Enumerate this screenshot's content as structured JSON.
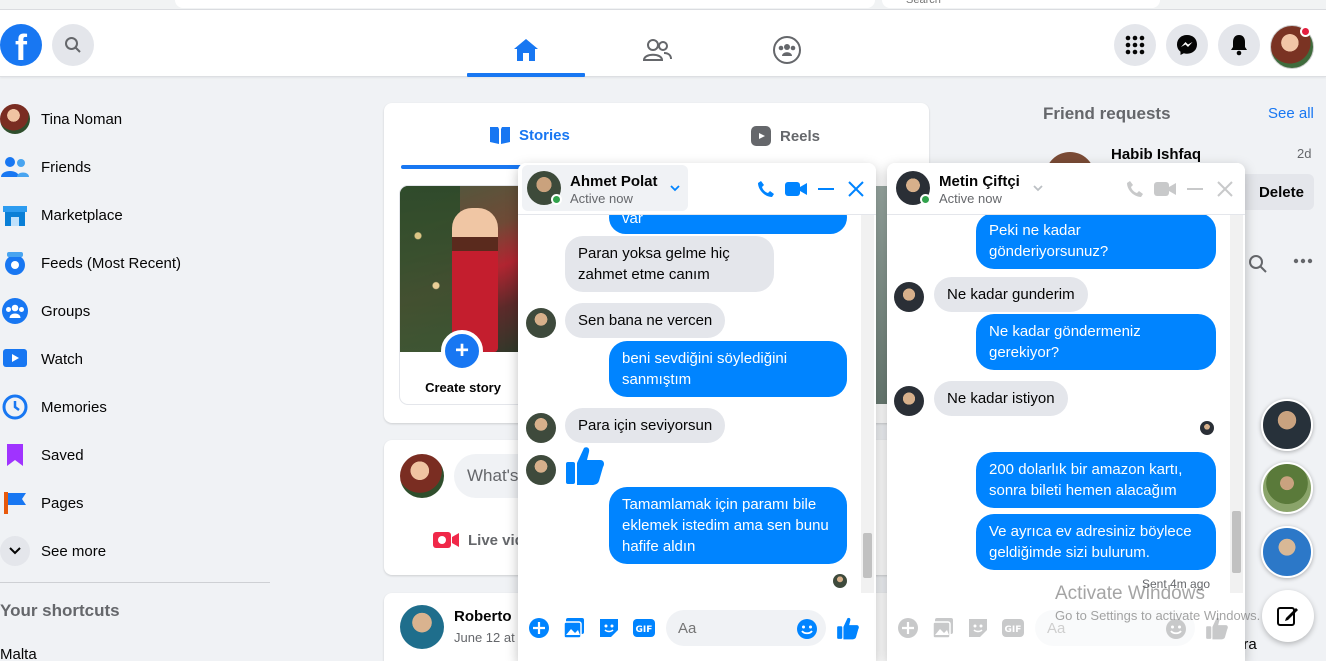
{
  "browser": {
    "search_placeholder": "Search"
  },
  "topbar": {
    "logo": "f",
    "colors": {
      "brand": "#1877f2",
      "notif_dot": "#e41e3f"
    }
  },
  "sidebar": {
    "items": [
      {
        "label": "Tina Noman",
        "icon": "profile-avatar"
      },
      {
        "label": "Friends",
        "icon": "friends-icon"
      },
      {
        "label": "Marketplace",
        "icon": "marketplace-icon"
      },
      {
        "label": "Feeds (Most Recent)",
        "icon": "feeds-icon"
      },
      {
        "label": "Groups",
        "icon": "groups-icon"
      },
      {
        "label": "Watch",
        "icon": "watch-icon"
      },
      {
        "label": "Memories",
        "icon": "memories-icon"
      },
      {
        "label": "Saved",
        "icon": "saved-icon"
      },
      {
        "label": "Pages",
        "icon": "pages-icon"
      },
      {
        "label": "See more",
        "icon": "chevron-down-icon"
      }
    ],
    "shortcuts_title": "Your shortcuts",
    "shortcut_item": "Malta"
  },
  "feed": {
    "tabs": {
      "stories": "Stories",
      "reels": "Reels"
    },
    "create_story": "Create story",
    "composer_placeholder": "What's",
    "live_video": "Live vid",
    "post_author": "Roberto",
    "post_date": "June 12 at"
  },
  "right": {
    "friend_requests": "Friend requests",
    "see_all": "See all",
    "request_name": "Habib Ishfaq",
    "request_age": "2d",
    "delete": "Delete",
    "tail_text": "ira"
  },
  "watermark": {
    "title": "Activate Windows",
    "sub": "Go to Settings to activate Windows."
  },
  "chat1": {
    "name": "Ahmet Polat",
    "status": "Active now",
    "messages": [
      {
        "dir": "out",
        "text": "var"
      },
      {
        "dir": "in",
        "text": "Paran yoksa gelme hiç zahmet etme canım"
      },
      {
        "dir": "in",
        "text": "Sen bana ne vercen"
      },
      {
        "dir": "out",
        "text": "beni sevdiğini söylediğini sanmıştım"
      },
      {
        "dir": "in",
        "text": "Para için seviyorsun"
      },
      {
        "dir": "in",
        "text": "like-sticker"
      },
      {
        "dir": "out",
        "text": "Tamamlamak için paramı bile eklemek istedim ama sen bunu hafife aldın"
      }
    ],
    "input_placeholder": "Aa"
  },
  "chat2": {
    "name": "Metin Çiftçi",
    "status": "Active now",
    "messages": [
      {
        "dir": "out",
        "text": "Peki ne kadar gönderiyorsunuz?"
      },
      {
        "dir": "in",
        "text": "Ne kadar gunderim"
      },
      {
        "dir": "out",
        "text": "Ne kadar göndermeniz gerekiyor?"
      },
      {
        "dir": "in",
        "text": "Ne kadar istiyon"
      },
      {
        "dir": "out",
        "text": "200 dolarlık bir amazon kartı, sonra bileti hemen alacağım"
      },
      {
        "dir": "out",
        "text": "Ve ayrıca ev adresiniz böylece geldiğimde sizi bulurum."
      }
    ],
    "sent_info": "Sent 4m ago",
    "input_placeholder": "Aa"
  },
  "colors": {
    "bubble_out": "#0084ff",
    "bubble_in": "#e4e6eb",
    "online": "#31a24c"
  }
}
